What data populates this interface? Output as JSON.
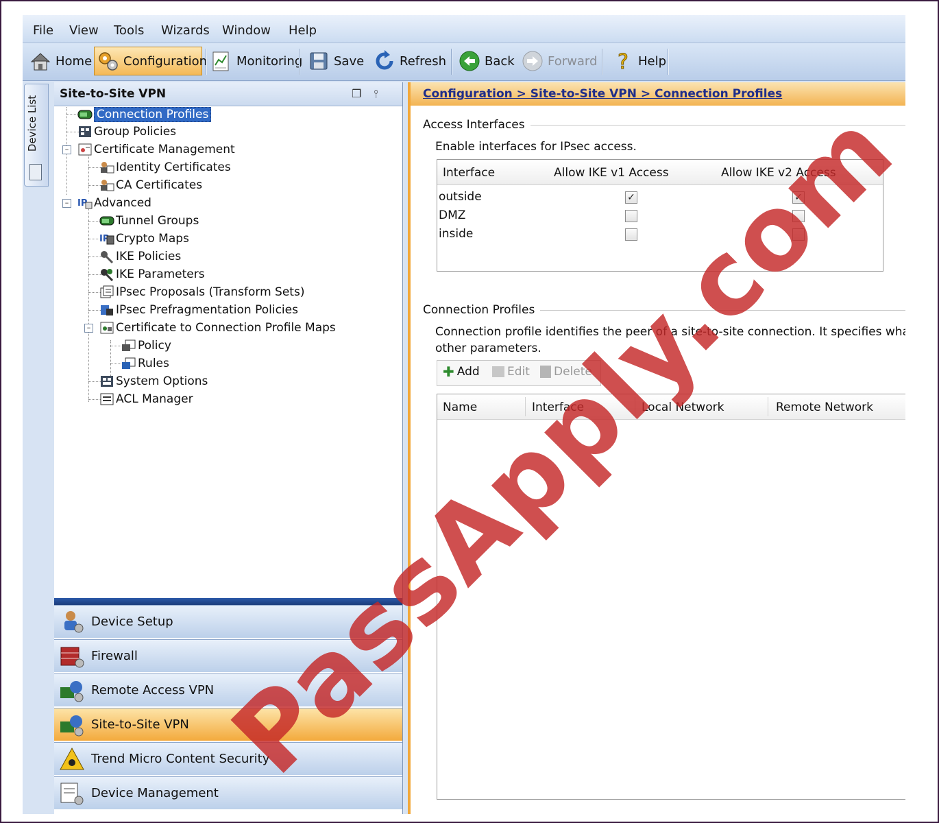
{
  "menu": [
    "File",
    "View",
    "Tools",
    "Wizards",
    "Window",
    "Help"
  ],
  "toolbar": {
    "home": "Home",
    "configuration": "Configuration",
    "monitoring": "Monitoring",
    "save": "Save",
    "refresh": "Refresh",
    "back": "Back",
    "forward": "Forward",
    "help": "Help"
  },
  "device_list_tab": "Device List",
  "left_panel": {
    "title": "Site-to-Site VPN",
    "tree": [
      {
        "label": "Connection Profiles",
        "selected": true
      },
      {
        "label": "Group Policies"
      },
      {
        "label": "Certificate Management"
      },
      {
        "label": "Identity Certificates"
      },
      {
        "label": "CA Certificates"
      },
      {
        "label": "Advanced"
      },
      {
        "label": "Tunnel Groups"
      },
      {
        "label": "Crypto Maps"
      },
      {
        "label": "IKE Policies"
      },
      {
        "label": "IKE Parameters"
      },
      {
        "label": "IPsec Proposals (Transform Sets)"
      },
      {
        "label": "IPsec Prefragmentation Policies"
      },
      {
        "label": "Certificate to Connection Profile Maps"
      },
      {
        "label": "Policy"
      },
      {
        "label": "Rules"
      },
      {
        "label": "System Options"
      },
      {
        "label": "ACL Manager"
      }
    ],
    "nav": [
      {
        "label": "Device Setup"
      },
      {
        "label": "Firewall"
      },
      {
        "label": "Remote Access VPN"
      },
      {
        "label": "Site-to-Site VPN",
        "active": true
      },
      {
        "label": "Trend Micro Content Security"
      },
      {
        "label": "Device Management"
      }
    ]
  },
  "breadcrumb": "Configuration > Site-to-Site VPN > Connection Profiles",
  "access_interfaces": {
    "title": "Access Interfaces",
    "description": "Enable interfaces for IPsec access.",
    "columns": [
      "Interface",
      "Allow IKE v1 Access",
      "Allow IKE v2 Access"
    ],
    "rows": [
      {
        "interface": "outside",
        "ike_v1": true,
        "ike_v2": true
      },
      {
        "interface": "DMZ",
        "ike_v1": false,
        "ike_v2": false
      },
      {
        "interface": "inside",
        "ike_v1": false,
        "ike_v2": false
      }
    ]
  },
  "connection_profiles": {
    "title": "Connection Profiles",
    "description_line1": "Connection profile identifies the peer of a site-to-site connection. It specifies what data",
    "description_line2": "other parameters.",
    "add": "Add",
    "edit": "Edit",
    "delete": "Delete",
    "columns": [
      "Name",
      "Interface",
      "Local Network",
      "Remote Network"
    ]
  },
  "watermark": "PassApply.com",
  "colors": {
    "accent_orange": "#f3b453",
    "selection_blue": "#316ac5",
    "toolbar_blue": "#c6d8ef",
    "watermark_red": "#c42828"
  }
}
